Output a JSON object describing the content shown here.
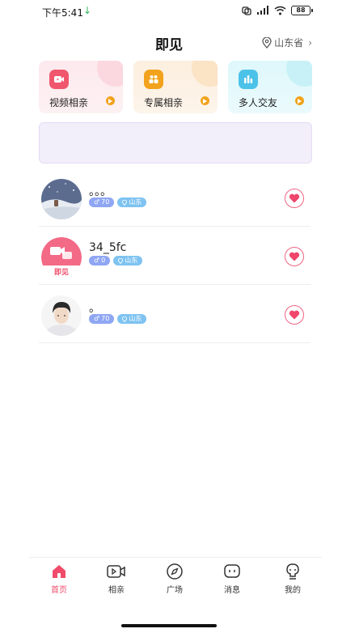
{
  "status_bar": {
    "time": "下午5:41",
    "download_icon": "down-arrow-icon",
    "battery_level": "88"
  },
  "header": {
    "title": "即见",
    "location": "山东省"
  },
  "categories": [
    {
      "label": "视频相亲",
      "icon": "video-icon",
      "color": "#f0566d"
    },
    {
      "label": "专属相亲",
      "icon": "people-icon",
      "color": "#f2a21c"
    },
    {
      "label": "多人交友",
      "icon": "group-icon",
      "color": "#4dc2e8"
    }
  ],
  "users": [
    {
      "name": "。。。",
      "gender_symbol": "♂",
      "age": "70",
      "location": "山东"
    },
    {
      "name": "34_5fc",
      "gender_symbol": "♂",
      "age": "0",
      "location": "山东",
      "avatar_text": "即见"
    },
    {
      "name": "。",
      "gender_symbol": "♂",
      "age": "70",
      "location": "山东"
    }
  ],
  "tabs": [
    {
      "label": "首页",
      "icon": "home-icon",
      "active": true
    },
    {
      "label": "相亲",
      "icon": "video-chat-icon",
      "active": false
    },
    {
      "label": "广场",
      "icon": "compass-icon",
      "active": false
    },
    {
      "label": "消息",
      "icon": "message-icon",
      "active": false
    },
    {
      "label": "我的",
      "icon": "profile-icon",
      "active": false
    }
  ],
  "colors": {
    "accent": "#f04b6a",
    "tag_age": "#8fa6f3",
    "tag_location": "#7ec3f1"
  }
}
